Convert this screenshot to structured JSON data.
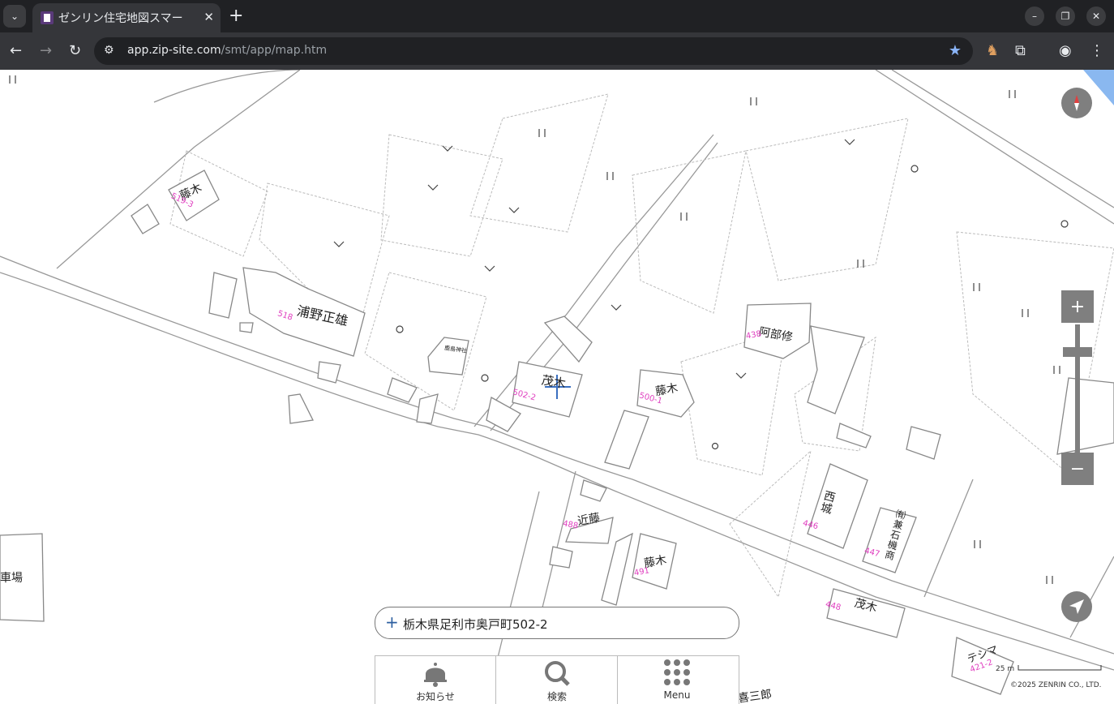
{
  "browser": {
    "tab_title": "ゼンリン住宅地図スマー",
    "url_host": "app.zip-site.com",
    "url_path": "/smt/app/map.htm"
  },
  "map": {
    "labels": {
      "fujiki1": "藤木",
      "urano": "浦野正雄",
      "shrine": "鹿島神社",
      "shigeki1": "茂木",
      "fujiki2": "藤木",
      "abe": "阿部修",
      "kondo": "近藤",
      "fujiki3": "藤木",
      "saijo": "西城",
      "kaneishi": "㈲兼石機商",
      "shigeki2": "茂木",
      "tesima": "テシマ",
      "kisaburo": "喜三郎",
      "parking": "車場"
    },
    "numbers": {
      "n519": "519-3",
      "n518": "518",
      "n502": "502-2",
      "n500": "500-1",
      "n438": "438",
      "n488": "488",
      "n491": "491",
      "n446": "446",
      "n447": "447",
      "n448": "448",
      "n421": "421-2"
    },
    "search_address": "栃木県足利市奥戸町502-2",
    "scale_label": "25 m",
    "copyright": "©2025 ZENRIN CO., LTD."
  },
  "bottom_bar": {
    "notice_label": "お知らせ",
    "search_label": "検索",
    "menu_label": "Menu"
  },
  "controls": {
    "zoom_in_symbol": "+",
    "zoom_out_symbol": "−"
  }
}
